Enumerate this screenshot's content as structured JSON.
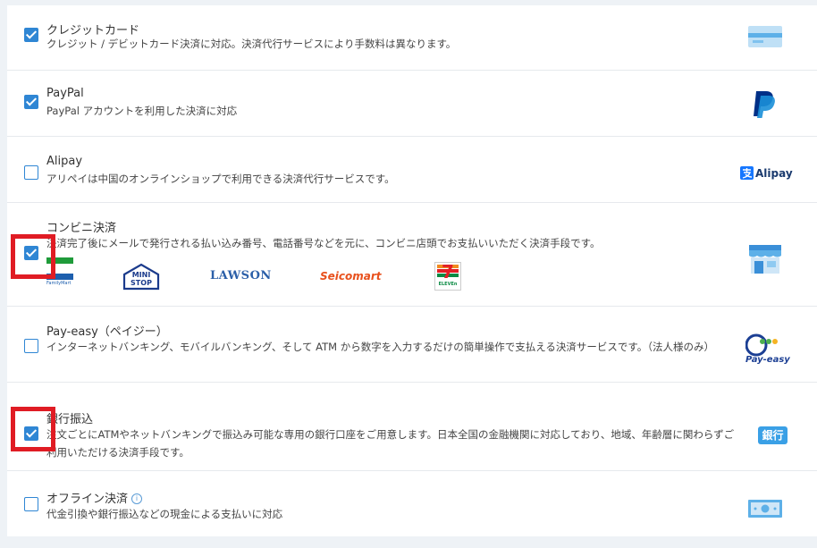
{
  "methods": [
    {
      "title": "クレジットカード",
      "desc": "クレジット / デビットカード決済に対応。決済代行サービスにより手数料は異なります。",
      "checked": true
    },
    {
      "title": "PayPal",
      "desc": "PayPal アカウントを利用した決済に対応",
      "checked": true
    },
    {
      "title": "Alipay",
      "desc": "アリペイは中国のオンラインショップで利用できる決済代行サービスです。",
      "checked": false,
      "logo_text": "Alipay"
    },
    {
      "title": "コンビニ決済",
      "desc": "決済完了後にメールで発行される払い込み番号、電話番号などを元に、コンビニ店頭でお支払いいただく決済手段です。",
      "checked": true,
      "stores": {
        "familymart": "FamilyMart",
        "ministop_line1": "MINI",
        "ministop_line2": "STOP",
        "lawson": "LAWSON",
        "seicomart": "Seicomart",
        "seven_number": "7",
        "seven_text": "ELEVEn"
      }
    },
    {
      "title": "Pay-easy（ペイジー）",
      "desc": "インターネットバンキング、モバイルバンキング、そして ATM から数字を入力するだけの簡単操作で支払える決済サービスです。（法人様のみ）",
      "checked": false,
      "logo_text": "Pay-easy"
    },
    {
      "title": "銀行振込",
      "desc": "注文ごとにATMやネットバンキングで振込み可能な専用の銀行口座をご用意します。日本全国の金融機関に対応しており、地域、年齢層に関わらずご利用いただける決済手段です。",
      "checked": true,
      "logo_text": "銀行"
    },
    {
      "title": "オフライン決済",
      "desc": "代金引換や銀行振込などの現金による支払いに対応",
      "checked": false,
      "info_icon": "i"
    }
  ],
  "colors": {
    "accent": "#2f86d4",
    "highlight": "#e01c24"
  }
}
